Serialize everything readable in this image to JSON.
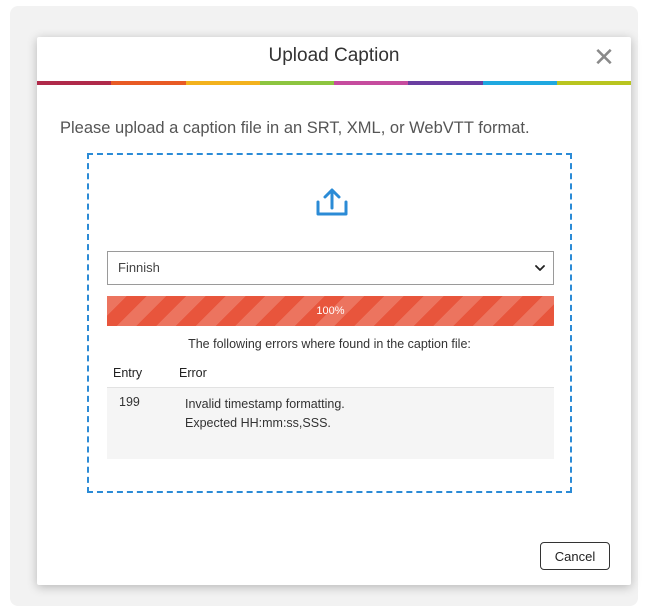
{
  "dialog": {
    "title": "Upload Caption",
    "close_glyph": "✕",
    "stripe_colors": [
      "#b02a4a",
      "#e85a24",
      "#f3b21d",
      "#8dc540",
      "#c64c9e",
      "#6a3ea1",
      "#1fa8e0",
      "#b9c520"
    ],
    "instruction": "Please upload a caption file in an SRT, XML, or WebVTT format.",
    "upload_icon": "upload-icon",
    "accent_color": "#2b8bd6",
    "language_select": {
      "selected": "Finnish"
    },
    "progress": {
      "percent": 100,
      "label": "100%",
      "color": "#e8553c"
    },
    "error_message": "The following errors where found in the caption file:",
    "error_table": {
      "headers": {
        "entry": "Entry",
        "error": "Error"
      },
      "rows": [
        {
          "entry": "199",
          "error_line1": "Invalid timestamp formatting.",
          "error_line2": "Expected HH:mm:ss,SSS."
        }
      ]
    },
    "cancel_label": "Cancel"
  }
}
